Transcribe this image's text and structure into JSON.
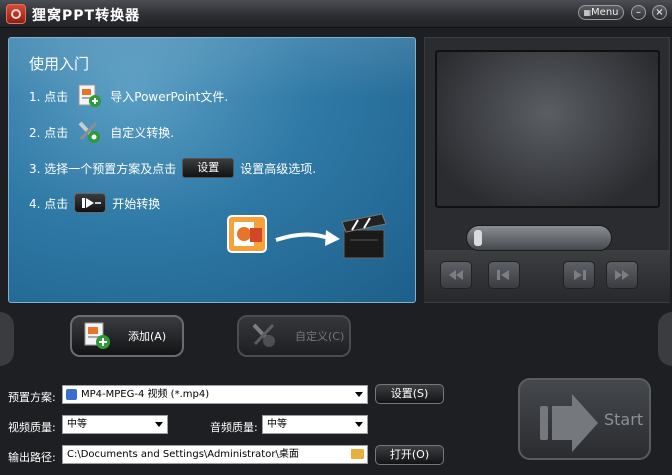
{
  "titlebar": {
    "title": "狸窝PPT转换器",
    "menu_label": "Menu",
    "minimize_glyph": "–",
    "close_glyph": "×"
  },
  "guide": {
    "title": "使用入门",
    "step1_prefix": "1. 点击",
    "step1_suffix": "导入PowerPoint文件.",
    "step2_prefix": "2. 点击",
    "step2_suffix": "自定义转换.",
    "step3_prefix": "3. 选择一个预置方案及点击",
    "step3_button": "设置",
    "step3_suffix": "设置高级选项.",
    "step4_prefix": "4. 点击",
    "step4_suffix": "开始转换"
  },
  "actions": {
    "add_label": "添加(A)",
    "custom_label": "自定义(C)"
  },
  "settings": {
    "preset_label": "预置方案:",
    "preset_value": "MP4-MPEG-4 视频 (*.mp4)",
    "preset_button": "设置(S)",
    "video_quality_label": "视频质量:",
    "video_quality_value": "中等",
    "audio_quality_label": "音频质量:",
    "audio_quality_value": "中等",
    "output_label": "输出路径:",
    "output_value": "C:\\Documents and Settings\\Administrator\\桌面",
    "open_button": "打开(O)"
  },
  "start": {
    "label": "Start"
  },
  "preview": {
    "progress": 0.0
  },
  "colors": {
    "guide_panel": "#2f79a6",
    "background": "#1d1f22",
    "accent_red": "#d64a3a"
  },
  "icons": [
    "app-logo-icon",
    "ppt-import-icon",
    "tools-icon",
    "play-icon",
    "powerpoint-icon",
    "arrow-icon",
    "clapperboard-icon",
    "rewind-icon",
    "prev-icon",
    "next-icon",
    "forward-icon",
    "folder-icon",
    "preset-icon"
  ]
}
